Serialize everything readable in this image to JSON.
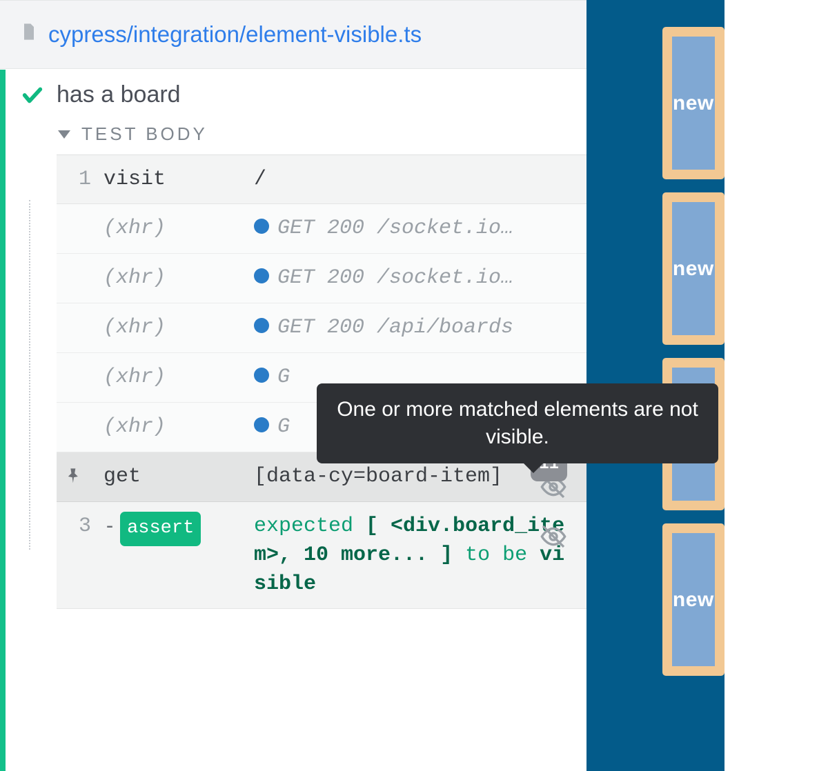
{
  "file": {
    "path": "cypress/integration/element-visible.ts"
  },
  "test": {
    "title": "has a board",
    "body_label": "TEST BODY"
  },
  "tooltip": {
    "text": "One or more matched elements are not visible."
  },
  "commands": {
    "visit": {
      "num": "1",
      "name": "visit",
      "msg": "/"
    },
    "xhr1": {
      "name": "(xhr)",
      "msg": "GET 200 /socket.io…"
    },
    "xhr2": {
      "name": "(xhr)",
      "msg": "GET 200 /socket.io…"
    },
    "xhr3": {
      "name": "(xhr)",
      "msg": "GET 200 /api/boards"
    },
    "xhr4": {
      "name": "(xhr)",
      "msg": "G"
    },
    "xhr5": {
      "name": "(xhr)",
      "msg": "G"
    },
    "get": {
      "name": "get",
      "msg": "[data-cy=board-item]",
      "count": "11"
    },
    "assert": {
      "num": "3",
      "badge": "assert",
      "p1": "expected ",
      "p2": "[ ",
      "p3": "<div.board_item>",
      "p4": ", 10 more... ",
      "p5": "]",
      "p6": " to be ",
      "p7": "visible"
    }
  },
  "aut": {
    "card_label": "new"
  }
}
